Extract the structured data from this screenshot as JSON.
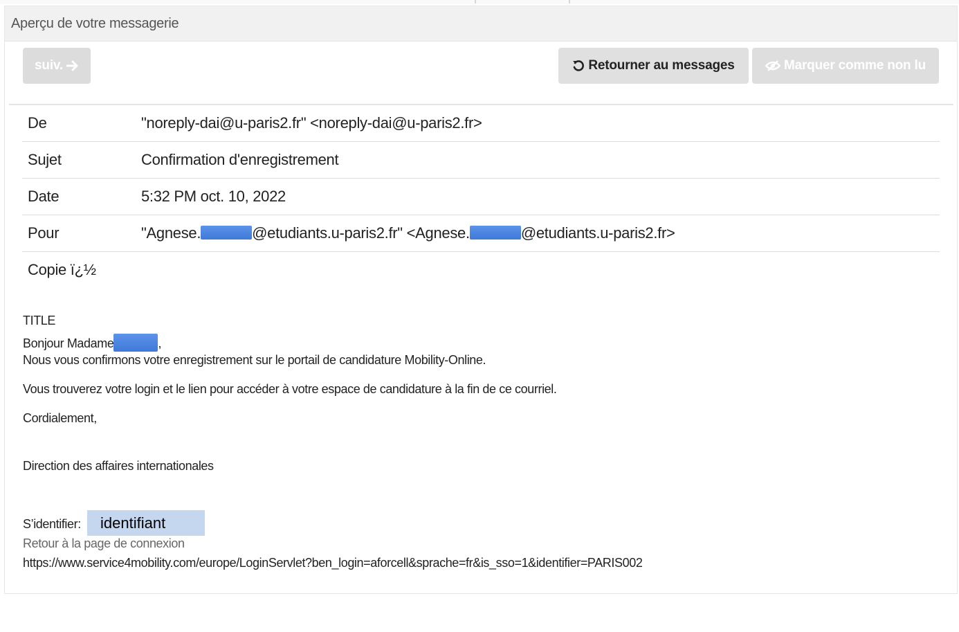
{
  "panel": {
    "title": "Aperçu de votre messagerie"
  },
  "toolbar": {
    "next_label": "suiv.",
    "back_label": "Retourner au messages",
    "mark_unread_label": "Marquer comme non lu"
  },
  "message": {
    "fields": [
      {
        "label": "De",
        "value": "\"noreply-dai@u-paris2.fr\" <noreply-dai@u-paris2.fr>"
      },
      {
        "label": "Sujet",
        "value": "Confirmation d'enregistrement"
      },
      {
        "label": "Date",
        "value": "5:32 PM oct. 10, 2022"
      },
      {
        "label": "Pour",
        "value_parts": [
          "\"Agnese.",
          "@etudiants.u-paris2.fr\" <Agnese.",
          "@etudiants.u-paris2.fr>"
        ]
      },
      {
        "label": "Copie ï¿½",
        "value": ""
      }
    ],
    "body": {
      "title": "TITLE",
      "greeting_prefix": "Bonjour Madame",
      "greeting_suffix": ",",
      "line1": "Nous vous confirmons votre enregistrement sur le portail de candidature Mobility-Online.",
      "line2": "Vous trouverez votre login et le lien pour accéder à votre espace de candidature à la fin de ce courriel.",
      "closing": "Cordialement,",
      "signature": "Direction des affaires internationales",
      "login_label": "S’identifier:",
      "login_value": "identifiant",
      "return_link": "Retour à la page de connexion",
      "url": "https://www.service4mobility.com/europe/LoginServlet?ben_login=aforcell&sprache=fr&is_sso=1&identifier=PARIS002"
    }
  },
  "colors": {
    "redaction": "#4a84e2",
    "login_highlight": "#c5d7ef",
    "button_disabled": "#dcdcdc",
    "button_default": "#e0e0e0"
  }
}
